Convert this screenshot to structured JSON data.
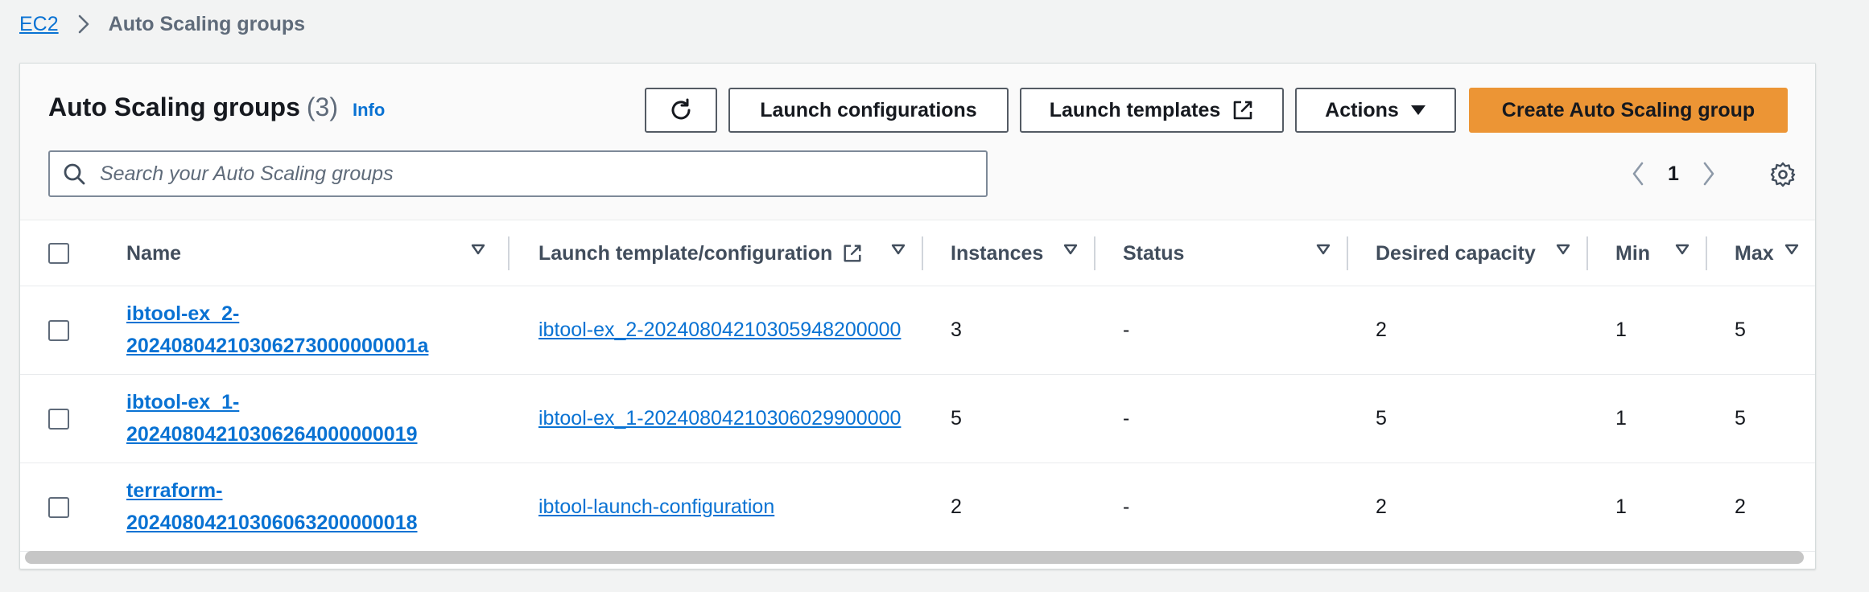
{
  "breadcrumb": {
    "root": "EC2",
    "current": "Auto Scaling groups"
  },
  "header": {
    "title": "Auto Scaling groups",
    "count": "(3)",
    "info": "Info"
  },
  "toolbar": {
    "refresh_icon": "refresh-icon",
    "launch_configurations": "Launch configurations",
    "launch_templates": "Launch templates",
    "actions": "Actions",
    "create": "Create Auto Scaling group"
  },
  "search": {
    "placeholder": "Search your Auto Scaling groups",
    "value": ""
  },
  "pagination": {
    "current_page": "1"
  },
  "table": {
    "columns": {
      "name": "Name",
      "launch_template": "Launch template/configuration",
      "instances": "Instances",
      "status": "Status",
      "desired_capacity": "Desired capacity",
      "min": "Min",
      "max": "Max"
    },
    "rows": [
      {
        "name_line1": "ibtool-ex_2-",
        "name_line2": "20240804210306273000000001a",
        "launch_template": "ibtool-ex_2-20240804210305948200000",
        "instances": "3",
        "status": "-",
        "desired_capacity": "2",
        "min": "1",
        "max": "5"
      },
      {
        "name_line1": "ibtool-ex_1-",
        "name_line2": "20240804210306264000000019",
        "launch_template": "ibtool-ex_1-20240804210306029900000",
        "instances": "5",
        "status": "-",
        "desired_capacity": "5",
        "min": "1",
        "max": "5"
      },
      {
        "name_line1": "terraform-",
        "name_line2": "20240804210306063200000018",
        "launch_template": "ibtool-launch-configuration",
        "instances": "2",
        "status": "-",
        "desired_capacity": "2",
        "min": "1",
        "max": "2"
      }
    ]
  },
  "colors": {
    "link": "#0972d3",
    "primary_button": "#ec9535",
    "page_background": "#f2f3f3",
    "header_text": "#414d5c"
  }
}
